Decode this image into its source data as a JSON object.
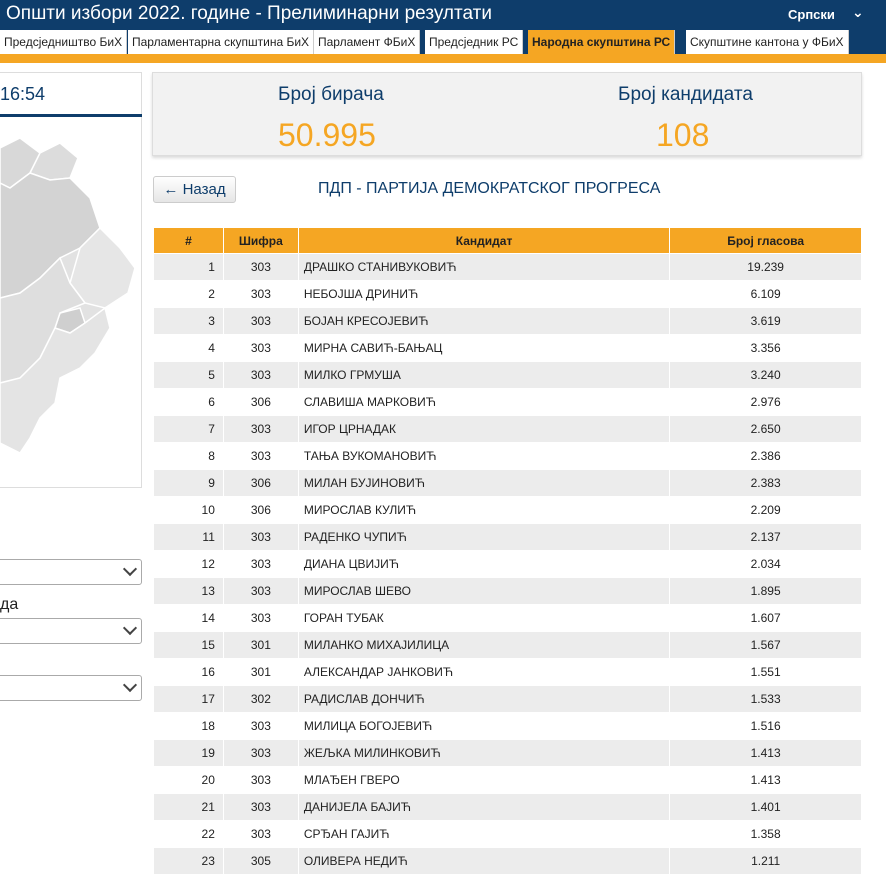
{
  "header": {
    "title": "Општи избори 2022. године - Прелиминарни резултати",
    "language": "Српски",
    "language_caret": "⌄"
  },
  "tabs": [
    {
      "label": "Предсједништво БиХ",
      "active": false
    },
    {
      "label": "Парламентарна скупштина БиХ",
      "active": false
    },
    {
      "label": "Парламент ФБиХ",
      "active": false
    },
    {
      "label": "Предсједник РС",
      "active": false
    },
    {
      "label": "Народна скупштина РС",
      "active": true
    },
    {
      "label": "Скупштине кантона у ФБиХ",
      "active": false
    }
  ],
  "left": {
    "time_fragment": "16:54",
    "label_fragment": "да"
  },
  "stats": {
    "voters_label": "Број бирача",
    "voters_value": "50.995",
    "candidates_label": "Број кандидата",
    "candidates_value": "108"
  },
  "back_button": "← Назад",
  "party_heading": "ПДП - ПАРТИЈА ДЕМОКРАТСКОГ ПРОГРЕСА",
  "table": {
    "columns": [
      "#",
      "Шифра",
      "Кандидат",
      "Број гласова"
    ],
    "rows": [
      [
        "1",
        "303",
        "ДРАШКО СТАНИВУКОВИЋ",
        "19.239"
      ],
      [
        "2",
        "303",
        "НЕБОЈША ДРИНИЋ",
        "6.109"
      ],
      [
        "3",
        "303",
        "БОЈАН КРЕСОЈЕВИЋ",
        "3.619"
      ],
      [
        "4",
        "303",
        "МИРНА САВИЋ-БАЊАЦ",
        "3.356"
      ],
      [
        "5",
        "303",
        "МИЛКО ГРМУША",
        "3.240"
      ],
      [
        "6",
        "306",
        "СЛАВИША МАРКОВИЋ",
        "2.976"
      ],
      [
        "7",
        "303",
        "ИГОР ЦРНАДАК",
        "2.650"
      ],
      [
        "8",
        "303",
        "ТАЊА ВУКОМАНОВИЋ",
        "2.386"
      ],
      [
        "9",
        "306",
        "МИЛАН БУЈИНОВИЋ",
        "2.383"
      ],
      [
        "10",
        "306",
        "МИРОСЛАВ КУЛИЋ",
        "2.209"
      ],
      [
        "11",
        "303",
        "РАДЕНКО ЧУПИЋ",
        "2.137"
      ],
      [
        "12",
        "303",
        "ДИАНА ЦВИЈИЋ",
        "2.034"
      ],
      [
        "13",
        "303",
        "МИРОСЛАВ ШЕВО",
        "1.895"
      ],
      [
        "14",
        "303",
        "ГОРАН ТУБАК",
        "1.607"
      ],
      [
        "15",
        "301",
        "МИЛАНКО МИХАЈИЛИЦА",
        "1.567"
      ],
      [
        "16",
        "301",
        "АЛЕКСАНДАР ЈАНКОВИЋ",
        "1.551"
      ],
      [
        "17",
        "302",
        "РАДИСЛАВ ДОНЧИЋ",
        "1.533"
      ],
      [
        "18",
        "303",
        "МИЛИЦА БОГОЈЕВИЋ",
        "1.516"
      ],
      [
        "19",
        "303",
        "ЖЕЉКА МИЛИНКОВИЋ",
        "1.413"
      ],
      [
        "20",
        "303",
        "МЛАЂЕН ГВЕРО",
        "1.413"
      ],
      [
        "21",
        "303",
        "ДАНИЈЕЛА БАЈИЋ",
        "1.401"
      ],
      [
        "22",
        "303",
        "СРЂАН ГАЈИЋ",
        "1.358"
      ],
      [
        "23",
        "305",
        "ОЛИВЕРА НЕДИЋ",
        "1.211"
      ]
    ]
  },
  "colors": {
    "navy": "#0e3d6b",
    "orange": "#f5a623",
    "row_alt": "#ececec"
  }
}
